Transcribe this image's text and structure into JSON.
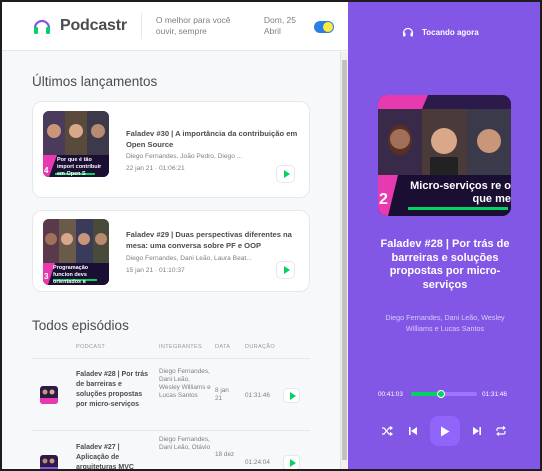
{
  "header": {
    "brand": "Podcastr",
    "tagline": "O melhor para você ouvir, sempre",
    "date": "Dom, 25 Abril"
  },
  "latest": {
    "title": "Últimos lançamentos",
    "episodes": [
      {
        "title": "Faladev #30 | A importância da contribuição em Open Source",
        "members": "Diego Fernandes, João Pedro, Diego ...",
        "date": "22 jan 21",
        "duration": "01:06:21",
        "thumb_text": "Por que é tão import contribuir em Open S",
        "thumb_num": "4"
      },
      {
        "title": "Faladev #29 | Duas perspectivas diferentes na mesa: uma conversa sobre PF e OOP",
        "members": "Diego Fernandes, Dani Leão, Laura Beat...",
        "date": "15 jan 21",
        "duration": "01:10:37",
        "thumb_text": "Programação funcion devs orientados a",
        "thumb_num": "3"
      }
    ]
  },
  "all": {
    "title": "Todos episódios",
    "columns": [
      "Podcast",
      "Integrantes",
      "Data",
      "Duração"
    ],
    "rows": [
      {
        "title": "Faladev #28 | Por trás de barreiras e soluções propostas por micro-serviços",
        "members": "Diego Fernandes, Dani Leão, Wesley Williams e Lucas Santos",
        "date": "8 jan 21",
        "duration": "01:31:46"
      },
      {
        "title": "Faladev #27 | Aplicação de arquiteturas MVC",
        "members": "Diego Fernandes, Dani Leão, Otávio",
        "date": "18 dez",
        "duration": "01:24:04"
      }
    ]
  },
  "player": {
    "label": "Tocando agora",
    "cover_text": "Micro-serviços re o que me",
    "cover_num": "2",
    "title": "Faladev #28 | Por trás de barreiras e soluções propostas por micro-serviços",
    "members": "Diego Fernandes, Dani Leão, Wesley Williams e Lucas Santos",
    "current_time": "00:41:03",
    "total_time": "01:31:46",
    "progress": 0.45
  },
  "colors": {
    "purple": "#8257e5",
    "green": "#04d361",
    "text": "#494d4b",
    "muted": "#808080"
  }
}
